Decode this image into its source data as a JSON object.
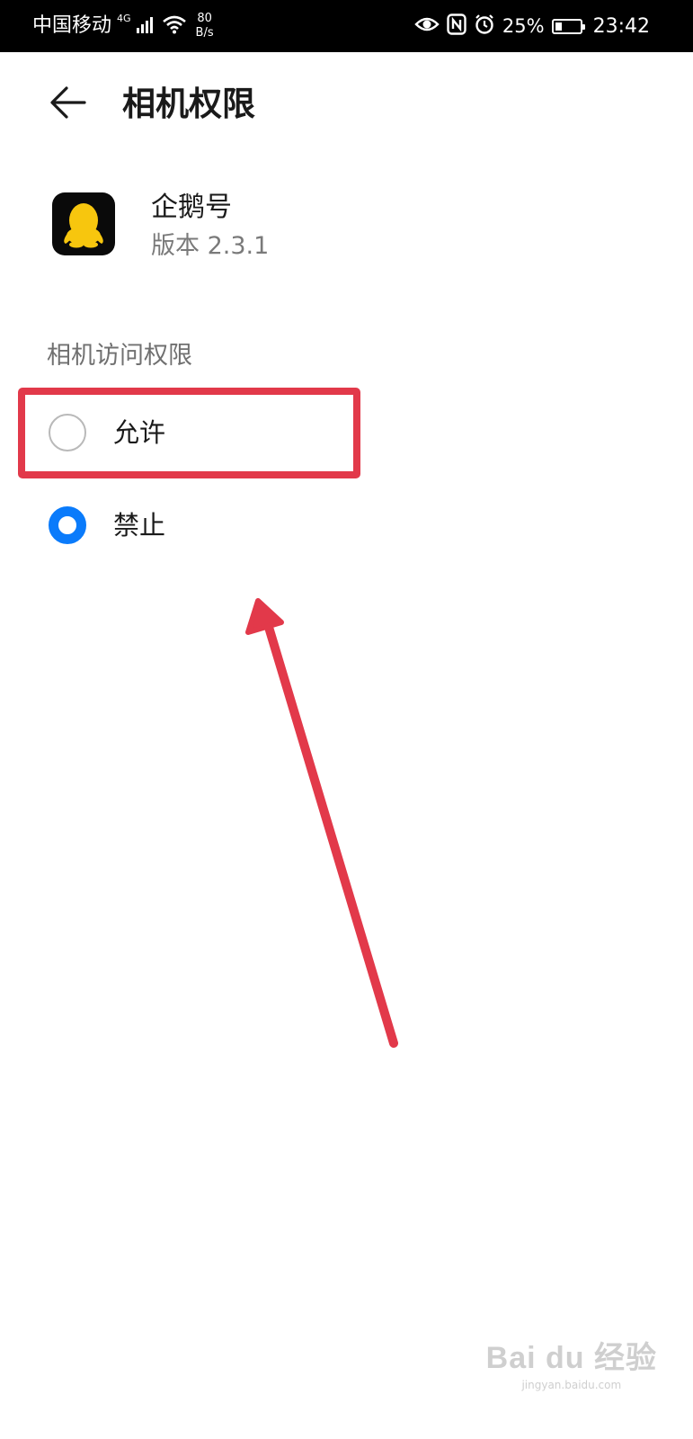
{
  "status_bar": {
    "carrier": "中国移动",
    "network_type": "4G",
    "speed_value": "80",
    "speed_unit": "B/s",
    "battery_percent": "25%",
    "battery_level": 0.25,
    "time": "23:42",
    "icons": [
      "signal-icon",
      "wifi-icon",
      "eye-icon",
      "nfc-icon",
      "alarm-icon",
      "battery-icon"
    ]
  },
  "header": {
    "back_icon": "back-arrow-icon",
    "title": "相机权限"
  },
  "app": {
    "icon": "penguin-app-icon",
    "name": "企鹅号",
    "version": "版本 2.3.1"
  },
  "permission": {
    "section_label": "相机访问权限",
    "options": [
      {
        "label": "允许",
        "selected": false
      },
      {
        "label": "禁止",
        "selected": true
      }
    ]
  },
  "annotation": {
    "highlight_color": "#e2394a",
    "arrow_color": "#e2394a"
  },
  "colors": {
    "accent": "#0a7bfb",
    "status_bar_bg": "#000000",
    "app_icon_bg": "#0a0a0a",
    "penguin_yellow": "#f7c60e"
  },
  "watermark": {
    "logo": "Bai du 经验",
    "url": "jingyan.baidu.com"
  }
}
